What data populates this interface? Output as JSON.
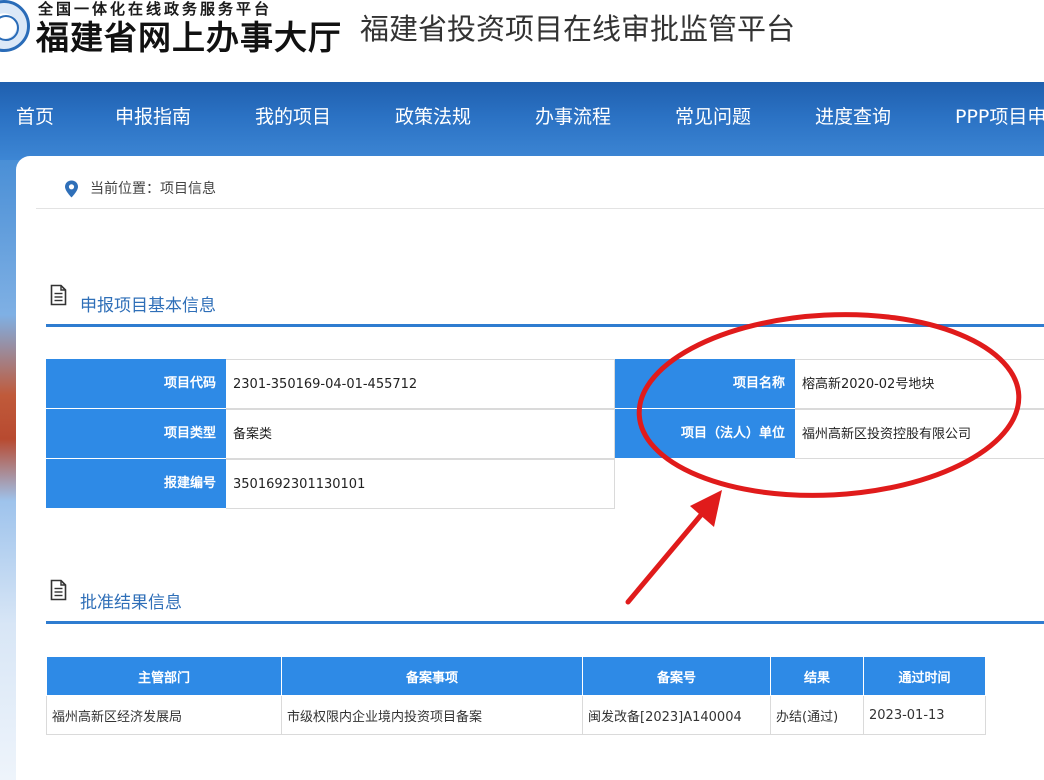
{
  "header": {
    "brand_subtitle": "全国一体化在线政务服务平台",
    "brand_name": "福建省网上办事大厅",
    "platform_title": "福建省投资项目在线审批监管平台"
  },
  "nav": {
    "items": [
      "首页",
      "申报指南",
      "我的项目",
      "政策法规",
      "办事流程",
      "常见问题",
      "进度查询",
      "PPP项目申"
    ]
  },
  "breadcrumb": {
    "text": "当前位置：项目信息"
  },
  "basic_info": {
    "section_title": "申报项目基本信息",
    "project_code_label": "项目代码",
    "project_code_value": "2301-350169-04-01-455712",
    "project_name_label": "项目名称",
    "project_name_value": "榕高新2020-02号地块",
    "project_type_label": "项目类型",
    "project_type_value": "备案类",
    "legal_unit_label": "项目（法人）单位",
    "legal_unit_value": "福州高新区投资控股有限公司",
    "filing_no_label": "报建编号",
    "filing_no_value": "3501692301130101"
  },
  "approval": {
    "section_title": "批准结果信息",
    "columns": [
      "主管部门",
      "备案事项",
      "备案号",
      "结果",
      "通过时间"
    ],
    "rows": [
      [
        "福州高新区经济发展局",
        "市级权限内企业境内投资项目备案",
        "闽发改备[2023]A140004",
        "办结(通过)",
        "2023-01-13"
      ]
    ]
  },
  "colors": {
    "nav_blue": "#2b72c4",
    "label_blue": "#2e8ae6",
    "section_blue": "#2f6fb8",
    "annotation_red": "#e01b1b"
  },
  "icons": {
    "location": "location-pin-icon",
    "document": "document-icon",
    "emblem": "platform-emblem-icon"
  }
}
